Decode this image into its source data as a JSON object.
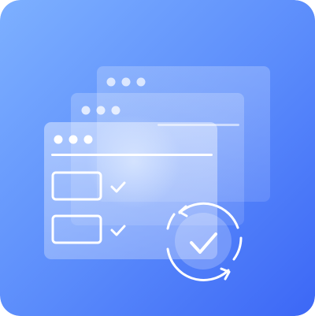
{
  "illustration": {
    "icon": "browser-windows-checklist-sync-icon",
    "colors": {
      "background_light": "#79A8FF",
      "background_dark": "#3F6DF8",
      "panel_stroke": "#FFFFFF",
      "glow": "#D7ECFF"
    },
    "windows": [
      {
        "name": "back-window",
        "dots": 3
      },
      {
        "name": "middle-window",
        "dots": 3
      },
      {
        "name": "front-window",
        "dots": 3
      }
    ],
    "checklist": [
      {
        "name": "checklist-item-1",
        "checked": true
      },
      {
        "name": "checklist-item-2",
        "checked": true
      }
    ],
    "sync_badge": "sync-check-icon"
  }
}
